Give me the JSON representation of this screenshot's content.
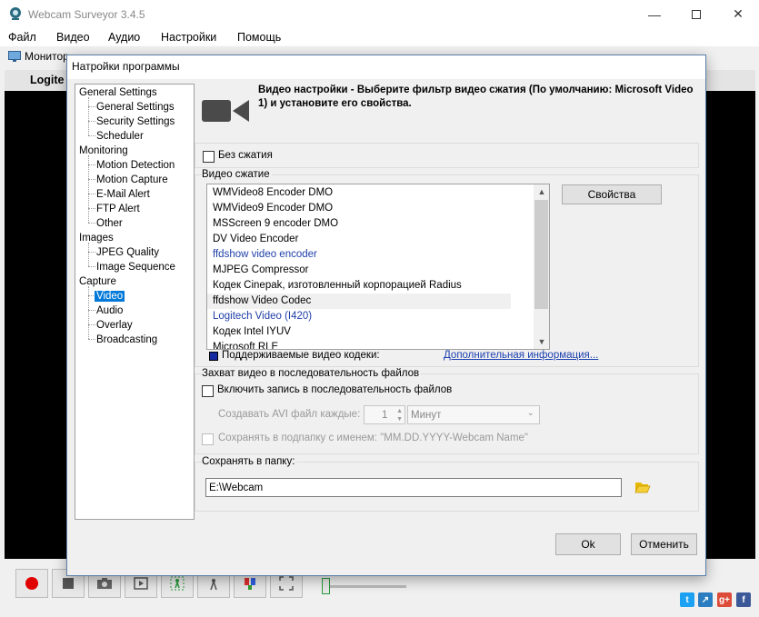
{
  "app": {
    "title": "Webcam Surveyor 3.4.5",
    "menu": [
      "Файл",
      "Видео",
      "Аудио",
      "Настройки",
      "Помощь"
    ],
    "monitor_tab": "Монитор",
    "camera_label": "Logite"
  },
  "dialog": {
    "title": "Натройки программы",
    "tree": {
      "sections": [
        {
          "label": "General Settings",
          "children": [
            "General Settings",
            "Security Settings",
            "Scheduler"
          ]
        },
        {
          "label": "Monitoring",
          "children": [
            "Motion Detection",
            "Motion Capture",
            "E-Mail Alert",
            "FTP Alert",
            "Other"
          ]
        },
        {
          "label": "Images",
          "children": [
            "JPEG Quality",
            "Image Sequence"
          ]
        },
        {
          "label": "Capture",
          "children": [
            "Video",
            "Audio",
            "Overlay",
            "Broadcasting"
          ]
        }
      ],
      "selected": "Video"
    },
    "header_text": "Видео настройки - Выберите фильтр видео сжатия (По умолчанию: Microsoft Video 1) и установите его свойства.",
    "no_compression_label": "Без сжатия",
    "compression_group_title": "Видео сжатие",
    "codecs": [
      {
        "name": "WMVideo8 Encoder DMO",
        "supported": false
      },
      {
        "name": "WMVideo9 Encoder DMO",
        "supported": false
      },
      {
        "name": "MSScreen 9 encoder DMO",
        "supported": false
      },
      {
        "name": "DV Video Encoder",
        "supported": false
      },
      {
        "name": "ffdshow video encoder",
        "supported": true
      },
      {
        "name": "MJPEG Compressor",
        "supported": false
      },
      {
        "name": "Кодек Cinepak, изготовленный корпорацией Radius",
        "supported": false
      },
      {
        "name": "ffdshow Video Codec",
        "supported": false,
        "highlighted": true
      },
      {
        "name": "Logitech Video (I420)",
        "supported": true
      },
      {
        "name": "Кодек Intel IYUV",
        "supported": false
      },
      {
        "name": "Microsoft RLE",
        "supported": false
      }
    ],
    "properties_button": "Свойства",
    "supported_legend": "Поддерживаемые видео кодеки:",
    "more_info_link": "Дополнительная информация...",
    "sequence_group_title": "Захват видео в последовательность файлов",
    "enable_sequence_label": "Включить запись в последовательность файлов",
    "create_avi_label": "Создавать AVI файл каждые:",
    "interval_value": "1",
    "interval_unit": "Минут",
    "subfolder_label": "Сохранять в подпапку с именем: \"MM.DD.YYYY-Webcam Name\"",
    "save_folder_title": "Сохранять в папку:",
    "save_folder_value": "E:\\Webcam",
    "ok_button": "Ok",
    "cancel_button": "Отменить"
  },
  "colors": {
    "selection": "#0078d7",
    "supported_codec": "#1f3fa8",
    "link": "#1a3fb0",
    "legend_square": "#1428a0"
  }
}
